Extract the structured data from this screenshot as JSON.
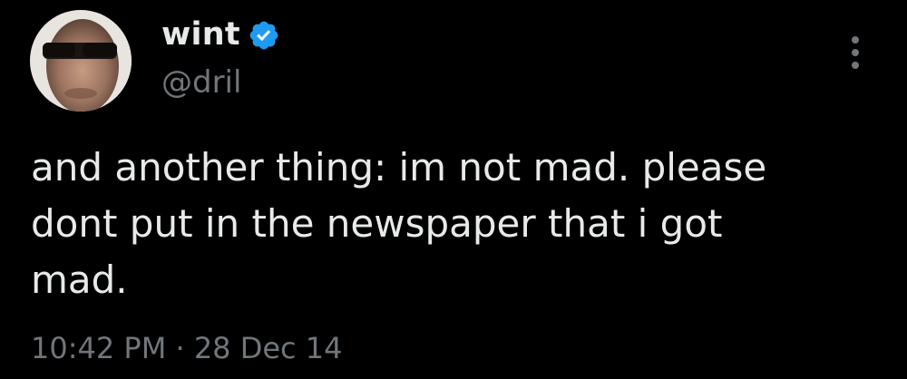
{
  "author": {
    "display_name": "wint",
    "handle": "@dril",
    "verified_icon": "verified-badge-icon",
    "verified_color": "#1d9bf0"
  },
  "tweet": {
    "text": "and another thing: im not mad. please\ndont put in the newspaper that i got\nmad.",
    "time": "10:42 PM",
    "separator": " · ",
    "date": "28 Dec 14"
  },
  "menu": {
    "icon": "more-options-icon"
  },
  "colors": {
    "background": "#000000",
    "primary_text": "#e7e9ea",
    "secondary_text": "#71767b"
  }
}
